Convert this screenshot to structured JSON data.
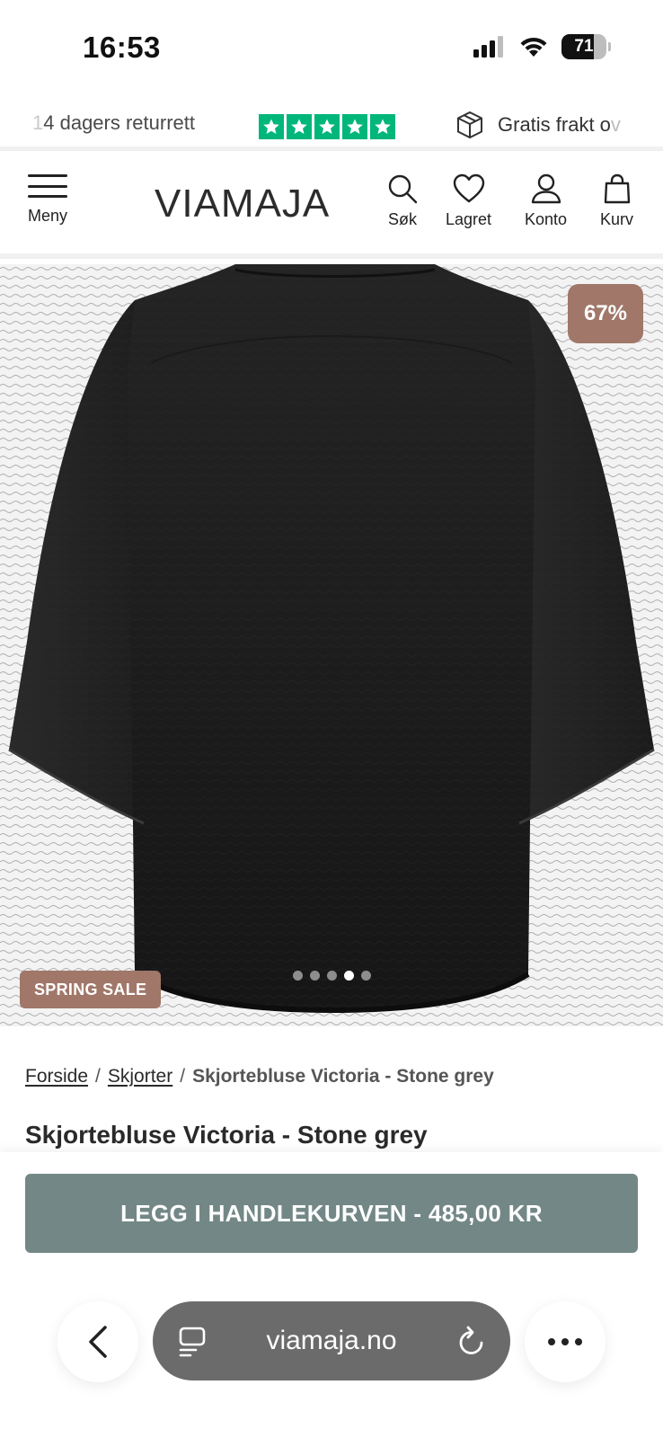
{
  "status_bar": {
    "time": "16:53",
    "battery_percent": "71",
    "battery_level": 0.71
  },
  "usp_bar": {
    "returns_text": "14 dagers returrett",
    "returns_visible_prefix": "1",
    "returns_visible_rest": "4 dagers returrett",
    "trustpilot_stars": 5,
    "trustpilot_color": "#00b67a",
    "shipping_visible": "Gratis frakt ov",
    "shipping_main": "Gratis frakt o",
    "shipping_fade": "v"
  },
  "header": {
    "menu_label": "Meny",
    "logo": "VIAMAJA",
    "search_label": "Søk",
    "saved_label": "Lagret",
    "account_label": "Konto",
    "cart_label": "Kurv"
  },
  "hero": {
    "discount_badge": "67%",
    "sale_badge": "SPRING SALE",
    "gallery_count": 5,
    "gallery_active_index": 3,
    "badge_color": "#a07769"
  },
  "breadcrumb": {
    "items": [
      "Forside",
      "Skjorter"
    ],
    "separator": "/",
    "current": "Skjortebluse Victoria - Stone grey"
  },
  "product": {
    "title": "Skjortebluse Victoria - Stone grey"
  },
  "cart": {
    "add_button_label": "LEGG I HANDLEKURVEN - 485,00 KR",
    "button_color": "#738886"
  },
  "browser": {
    "url": "viamaja.no"
  }
}
